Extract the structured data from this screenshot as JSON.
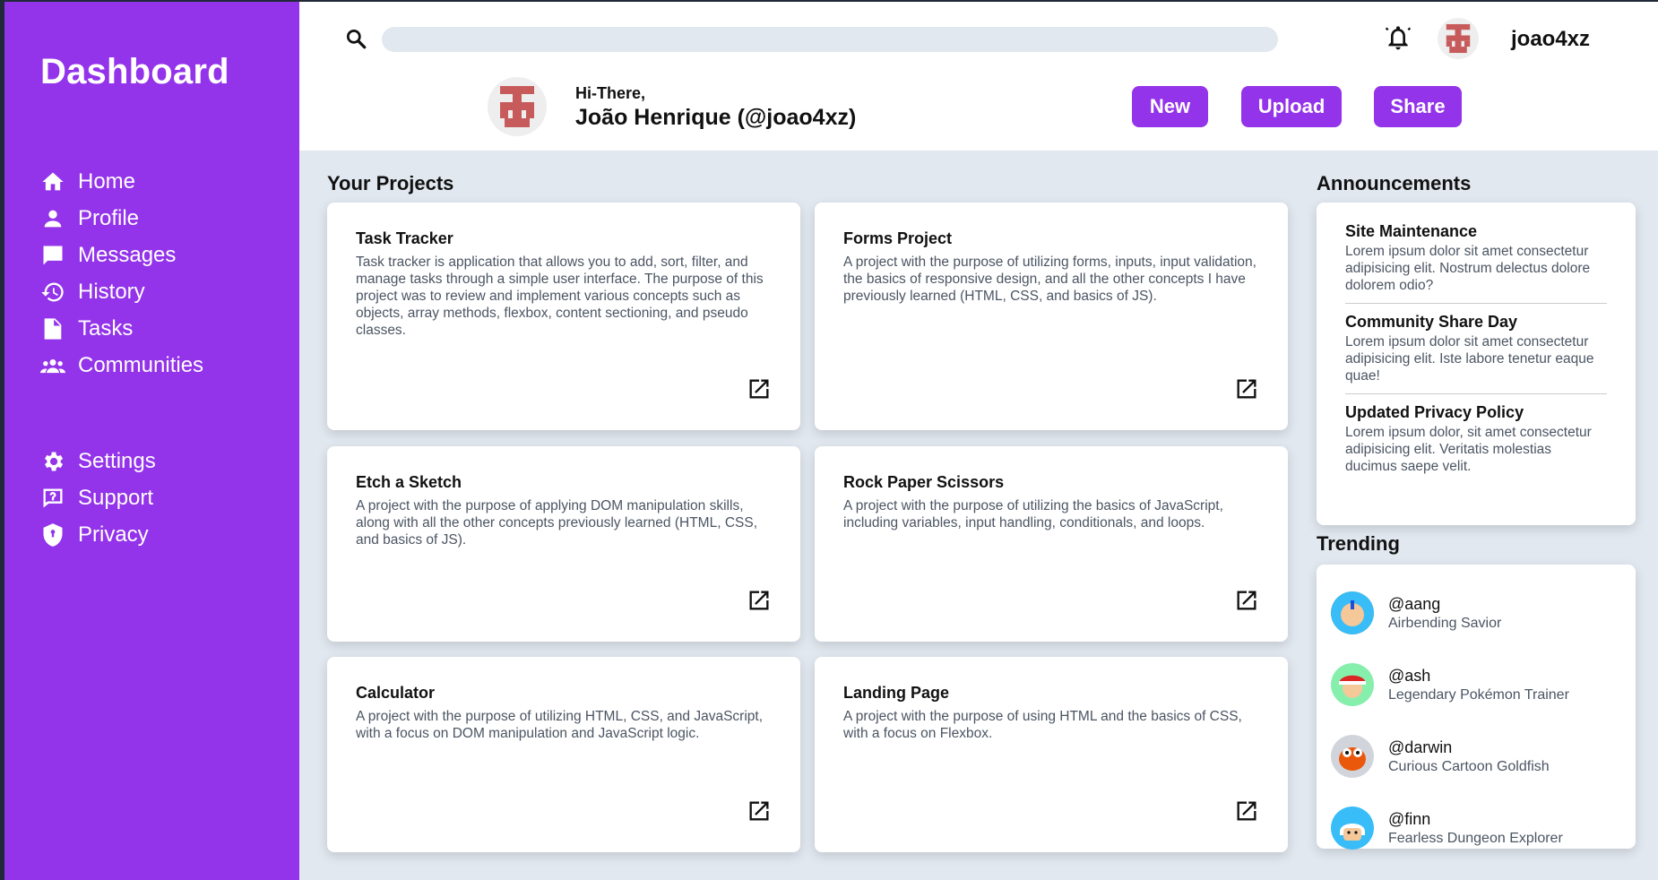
{
  "sidebar": {
    "title": "Dashboard",
    "main_items": [
      {
        "label": "Home",
        "icon": "home-icon"
      },
      {
        "label": "Profile",
        "icon": "user-icon"
      },
      {
        "label": "Messages",
        "icon": "chat-icon"
      },
      {
        "label": "History",
        "icon": "history-icon"
      },
      {
        "label": "Tasks",
        "icon": "document-icon"
      },
      {
        "label": "Communities",
        "icon": "group-icon"
      }
    ],
    "secondary_items": [
      {
        "label": "Settings",
        "icon": "gear-icon"
      },
      {
        "label": "Support",
        "icon": "help-icon"
      },
      {
        "label": "Privacy",
        "icon": "shield-icon"
      }
    ]
  },
  "header": {
    "search_placeholder": "",
    "username": "joao4xz",
    "greeting": "Hi-There,",
    "full_name": "João Henrique (@joao4xz)",
    "buttons": {
      "new": "New",
      "upload": "Upload",
      "share": "Share"
    }
  },
  "projects": {
    "title": "Your Projects",
    "items": [
      {
        "name": "Task Tracker",
        "description": "Task tracker is application that allows you to add, sort, filter, and manage tasks through a simple user interface. The purpose of this project was to review and implement various concepts such as objects, array methods, flexbox, content sectioning, and pseudo classes."
      },
      {
        "name": "Forms Project",
        "description": "A project with the purpose of utilizing forms, inputs, input validation, the basics of responsive design, and all the other concepts I have previously learned (HTML, CSS, and basics of JS)."
      },
      {
        "name": "Etch a Sketch",
        "description": "A project with the purpose of applying DOM manipulation skills, along with all the other concepts previously learned (HTML, CSS, and basics of JS)."
      },
      {
        "name": "Rock Paper Scissors",
        "description": "A project with the purpose of utilizing the basics of JavaScript, including variables, input handling, conditionals, and loops."
      },
      {
        "name": "Calculator",
        "description": "A project with the purpose of utilizing HTML, CSS, and JavaScript, with a focus on DOM manipulation and JavaScript logic."
      },
      {
        "name": "Landing Page",
        "description": "A project with the purpose of using HTML and the basics of CSS, with a focus on Flexbox."
      }
    ]
  },
  "announcements": {
    "title": "Announcements",
    "items": [
      {
        "title": "Site Maintenance",
        "body": "Lorem ipsum dolor sit amet consectetur adipisicing elit. Nostrum delectus dolore dolorem odio?"
      },
      {
        "title": "Community Share Day",
        "body": "Lorem ipsum dolor sit amet consectetur adipisicing elit. Iste labore tenetur eaque quae!"
      },
      {
        "title": "Updated Privacy Policy",
        "body": "Lorem ipsum dolor, sit amet consectetur adipisicing elit. Veritatis molestias ducimus saepe velit."
      }
    ]
  },
  "trending": {
    "title": "Trending",
    "items": [
      {
        "handle": "@aang",
        "description": "Airbending Savior",
        "color": "#f59e0b"
      },
      {
        "handle": "@ash",
        "description": "Legendary Pokémon Trainer",
        "color": "#dc2626"
      },
      {
        "handle": "@darwin",
        "description": "Curious Cartoon Goldfish",
        "color": "#ea580c"
      },
      {
        "handle": "@finn",
        "description": "Fearless Dungeon Explorer",
        "color": "#38bdf8"
      }
    ]
  },
  "colors": {
    "accent": "#9333ea",
    "background": "#e2e8f0",
    "avatar": "#c75b5b"
  }
}
